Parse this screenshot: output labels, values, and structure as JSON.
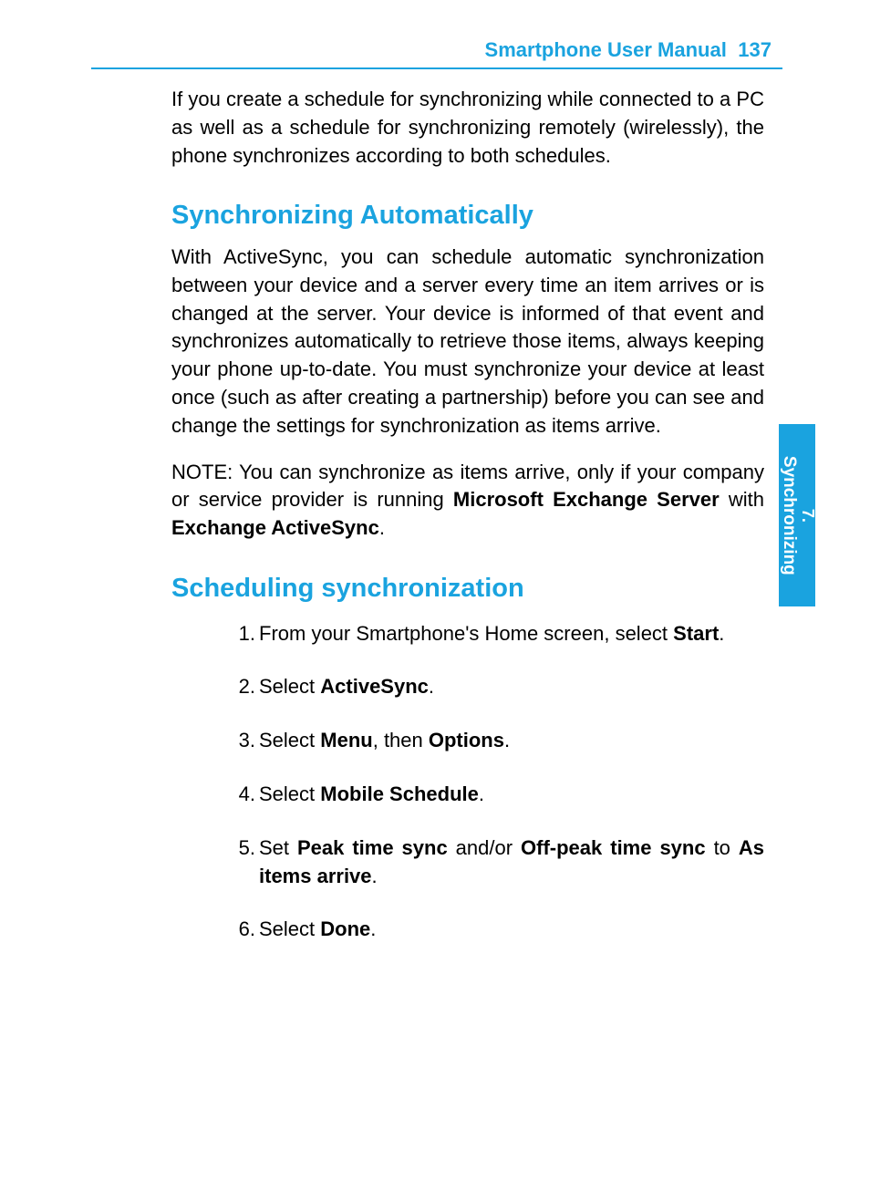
{
  "header": {
    "manual_title": "Smartphone User Manual",
    "page_number": "137"
  },
  "side_tab": {
    "chapter": "7.",
    "title": "Synchronizing"
  },
  "intro_para": "If you create a schedule for synchronizing while connected to a PC as well as a schedule for synchronizing remotely (wirelessly), the phone synchronizes according to both schedules.",
  "section1": {
    "heading": "Synchronizing Automatically",
    "para1": "With ActiveSync, you can schedule automatic synchro­nization between your device and a server every time an item arrives or is changed at the server.  Your device is informed of that event and synchronizes automatically to retrieve those items, always keeping your phone up-to-date.  You must synchronize your device at least once (such as after creating a partnership) before you can see and change the settings for synchronization as items arrive.",
    "note_prefix": "NOTE:  You can synchronize as items arrive, only if your company or service provider is running ",
    "note_bold1": "Microsoft Exchange Server",
    "note_mid": " with ",
    "note_bold2": "Exchange ActiveSync",
    "note_suffix": "."
  },
  "section2": {
    "heading": "Scheduling synchronization",
    "steps": {
      "s1_pre": "From your Smartphone's Home screen, select ",
      "s1_b": "Start",
      "s1_post": ".",
      "s2_pre": "Select ",
      "s2_b": "ActiveSync",
      "s2_post": ".",
      "s3_pre": "Select ",
      "s3_b1": "Menu",
      "s3_mid": ", then ",
      "s3_b2": "Options",
      "s3_post": ".",
      "s4_pre": "Select ",
      "s4_b": "Mobile Schedule",
      "s4_post": ".",
      "s5_pre": "Set ",
      "s5_b1": "Peak time sync",
      "s5_mid1": " and/or ",
      "s5_b2": "Off-peak time sync",
      "s5_mid2": " to ",
      "s5_b3": "As items arrive",
      "s5_post": ".",
      "s6_pre": "Select ",
      "s6_b": "Done",
      "s6_post": "."
    }
  }
}
